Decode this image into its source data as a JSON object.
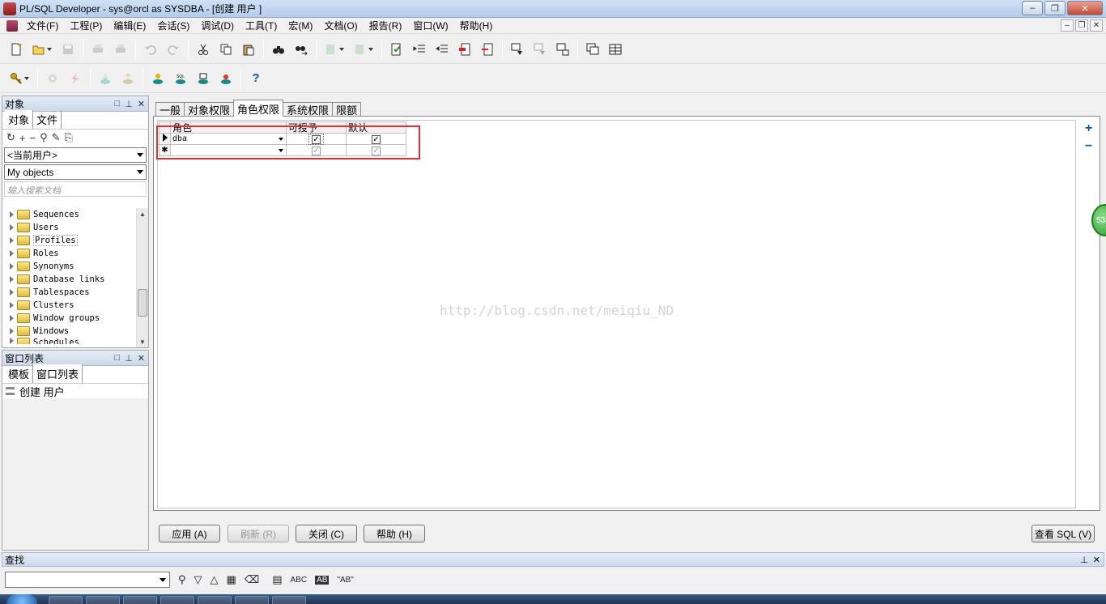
{
  "window": {
    "title": "PL/SQL Developer - sys@orcl as SYSDBA - [创建 用户 ]",
    "min": "‒",
    "max": "❐",
    "close": "✕"
  },
  "menu": [
    "文件(F)",
    "工程(P)",
    "编辑(E)",
    "会话(S)",
    "调试(D)",
    "工具(T)",
    "宏(M)",
    "文档(O)",
    "报告(R)",
    "窗口(W)",
    "帮助(H)"
  ],
  "mdi": {
    "min": "–",
    "restore": "❐",
    "close": "✕"
  },
  "toolbar2": {
    "help": "?"
  },
  "object_panel": {
    "title": "对象",
    "ctrls": [
      "□",
      "⊥",
      "✕"
    ],
    "tabs": [
      "对象",
      "文件"
    ],
    "tools": [
      "↻",
      "+",
      "−",
      "⚲",
      "✎",
      "⎘"
    ],
    "user_select": "<当前用户>",
    "objects_select": "My objects",
    "search_placeholder": "输入搜索文档",
    "tree": [
      "Sequences",
      "Users",
      "Profiles",
      "Roles",
      "Synonyms",
      "Database links",
      "Tablespaces",
      "Clusters",
      "Window groups",
      "Windows",
      "Schedules"
    ],
    "scroll_up": "▲",
    "scroll_down": "▼"
  },
  "window_panel": {
    "title": "窗口列表",
    "ctrls": [
      "□",
      "⊥",
      "✕"
    ],
    "tabs": [
      "模板",
      "窗口列表"
    ],
    "items": [
      "创建 用户"
    ]
  },
  "main": {
    "tabs": [
      "一般",
      "对象权限",
      "角色权限",
      "系统权限",
      "限额"
    ],
    "active_tab": 2,
    "grid": {
      "columns": [
        "角色",
        "可授予",
        "默认"
      ],
      "rows": [
        {
          "role": "dba",
          "grantable": "✓",
          "default": "✓"
        },
        {
          "role": "",
          "grantable": "✓",
          "default": "✓"
        }
      ],
      "new_row_marker": "✱"
    },
    "add_label": "+",
    "remove_label": "−",
    "watermark": "http://blog.csdn.net/meiqiu_ND",
    "badge": "53"
  },
  "buttons": {
    "apply": "应用 (A)",
    "refresh": "刷新 (R)",
    "close": "关闭 (C)",
    "help": "帮助 (H)",
    "view_sql": "查看 SQL (V)"
  },
  "find": {
    "title": "查找",
    "ctrls": [
      "⊥",
      "✕"
    ],
    "tools": [
      "⚲",
      "▽",
      "△",
      "▦",
      "⌫",
      "▤",
      "ABC",
      "AB",
      "\"AB\""
    ]
  }
}
